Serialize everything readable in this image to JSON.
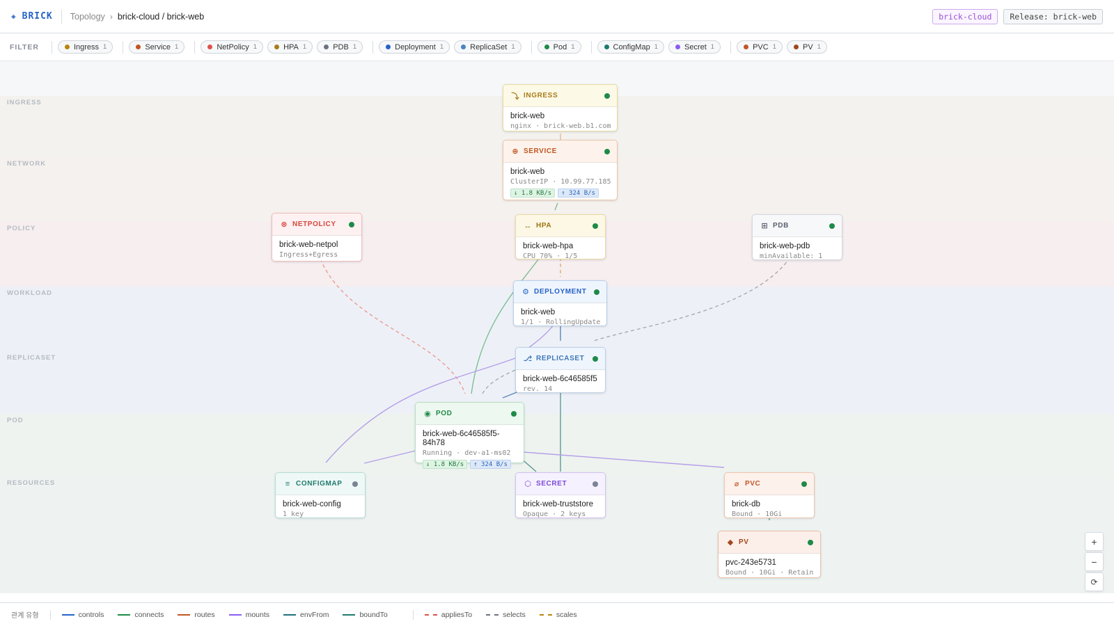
{
  "header": {
    "logo_glyph": "◈",
    "logo_text": "BRICK",
    "breadcrumb_root": "Topology",
    "breadcrumb_sep": "›",
    "breadcrumb_current": "brick-cloud / brick-web",
    "namespace_badge": "brick-cloud",
    "release_badge": "Release: brick-web"
  },
  "filter": {
    "label": "FILTER",
    "chips": [
      {
        "label": "Ingress",
        "count": "1",
        "color": "#b8860b"
      },
      {
        "label": "Service",
        "count": "1",
        "color": "#c05621"
      },
      {
        "label": "NetPolicy",
        "count": "1",
        "color": "#e0524a"
      },
      {
        "label": "HPA",
        "count": "1",
        "color": "#a77d1a"
      },
      {
        "label": "PDB",
        "count": "1",
        "color": "#6b7280"
      },
      {
        "label": "Deployment",
        "count": "1",
        "color": "#2563c9"
      },
      {
        "label": "ReplicaSet",
        "count": "1",
        "color": "#4a84c4"
      },
      {
        "label": "Pod",
        "count": "1",
        "color": "#1f8a48"
      },
      {
        "label": "ConfigMap",
        "count": "1",
        "color": "#1f7a6e"
      },
      {
        "label": "Secret",
        "count": "1",
        "color": "#8b5cf6"
      },
      {
        "label": "PVC",
        "count": "1",
        "color": "#c2552a"
      },
      {
        "label": "PV",
        "count": "1",
        "color": "#a0481e"
      }
    ]
  },
  "lanes": [
    {
      "label": "INGRESS",
      "color": "#f3f2ef"
    },
    {
      "label": "NETWORK",
      "color": "#f5f1ee"
    },
    {
      "label": "POLICY",
      "color": "#f6eeef"
    },
    {
      "label": "WORKLOAD",
      "color": "#edf1f7"
    },
    {
      "label": "REPLICASET",
      "color": "#edf1f7"
    },
    {
      "label": "POD",
      "color": "#eef3ef"
    },
    {
      "label": "RESOURCES",
      "color": "#eef3f1"
    }
  ],
  "nodes": {
    "ingress": {
      "kind": "INGRESS",
      "icon": "⤵",
      "name": "brick-web",
      "meta": "nginx · brick-web.b1.com",
      "accent": "#a77d1a",
      "head_bg": "#fdf9e7",
      "border": "#e8d9a0",
      "status_color": "#1f8a48"
    },
    "service": {
      "kind": "SERVICE",
      "icon": "⊕",
      "name": "brick-web",
      "meta": "ClusterIP · 10.99.77.185",
      "traffic_in": "↓ 1.8 KB/s",
      "traffic_out": "↑ 324 B/s",
      "accent": "#c05621",
      "head_bg": "#fdf3ec",
      "border": "#ecc6ab",
      "status_color": "#1f8a48"
    },
    "netpolicy": {
      "kind": "NETPOLICY",
      "icon": "⊗",
      "name": "brick-web-netpol",
      "meta": "Ingress+Egress",
      "accent": "#d9463e",
      "head_bg": "#fdf1f1",
      "border": "#f0bcbc",
      "status_color": "#1f8a48"
    },
    "hpa": {
      "kind": "HPA",
      "icon": "↔",
      "name": "brick-web-hpa",
      "meta": "CPU 70% · 1/5",
      "accent": "#9a7412",
      "head_bg": "#fdf8e6",
      "border": "#e8d9a0",
      "status_color": "#1f8a48"
    },
    "pdb": {
      "kind": "PDB",
      "icon": "⊞",
      "name": "brick-web-pdb",
      "meta": "minAvailable: 1",
      "accent": "#5a6270",
      "head_bg": "#f7f8fa",
      "border": "#d3d7de",
      "status_color": "#1f8a48"
    },
    "deployment": {
      "kind": "DEPLOYMENT",
      "icon": "⚙",
      "name": "brick-web",
      "meta": "1/1 · RollingUpdate",
      "accent": "#2563c9",
      "head_bg": "#eff5fd",
      "border": "#b7cdec",
      "status_color": "#1f8a48"
    },
    "replicaset": {
      "kind": "REPLICASET",
      "icon": "⎇",
      "name": "brick-web-6c46585f5",
      "meta": "rev. 14",
      "accent": "#3f78b8",
      "head_bg": "#eff5fd",
      "border": "#bcd0e8",
      "status_color": "#1f8a48"
    },
    "pod": {
      "kind": "POD",
      "icon": "◉",
      "name": "brick-web-6c46585f5-84h78",
      "meta": "Running · dev-a1-ms02",
      "traffic_in": "↓ 1.8 KB/s",
      "traffic_out": "↑ 324 B/s",
      "accent": "#1f8a48",
      "head_bg": "#edf8f0",
      "border": "#b6dfc2",
      "status_color": "#1f8a48"
    },
    "configmap": {
      "kind": "CONFIGMAP",
      "icon": "≡",
      "name": "brick-web-config",
      "meta": "1 key",
      "accent": "#1f7a6e",
      "head_bg": "#eef8f6",
      "border": "#b7ddd6",
      "status_color": "#7b8494"
    },
    "secret": {
      "kind": "SECRET",
      "icon": "⬡",
      "name": "brick-web-truststore",
      "meta": "Opaque · 2 keys",
      "accent": "#7c4bd6",
      "head_bg": "#f6f1fe",
      "border": "#d3c1f2",
      "status_color": "#7b8494"
    },
    "pvc": {
      "kind": "PVC",
      "icon": "⌀",
      "name": "brick-db",
      "meta": "Bound · 10Gi",
      "accent": "#c2552a",
      "head_bg": "#fdf1ec",
      "border": "#efc3ad",
      "status_color": "#1f8a48"
    },
    "pv": {
      "kind": "PV",
      "icon": "◆",
      "name": "pvc-243e5731",
      "meta": "Bound · 10Gi · Retain",
      "accent": "#a0481e",
      "head_bg": "#fcefe9",
      "border": "#ebbfa8",
      "status_color": "#1f8a48"
    }
  },
  "zoom": {
    "in": "+",
    "out": "−",
    "reset": "⟳"
  },
  "legend": {
    "title": "관계 유형",
    "items": [
      {
        "label": "controls",
        "color": "#2563c9",
        "dashed": false
      },
      {
        "label": "connects",
        "color": "#1f8a48",
        "dashed": false
      },
      {
        "label": "routes",
        "color": "#c05621",
        "dashed": false
      },
      {
        "label": "mounts",
        "color": "#8b5cf6",
        "dashed": false
      },
      {
        "label": "envFrom",
        "color": "#1f6f7a",
        "dashed": false
      },
      {
        "label": "boundTo",
        "color": "#1f7a6e",
        "dashed": false
      },
      {
        "label": "appliesTo",
        "color": "#e0524a",
        "dashed": true
      },
      {
        "label": "selects",
        "color": "#6b7280",
        "dashed": true
      },
      {
        "label": "scales",
        "color": "#b8860b",
        "dashed": true
      }
    ]
  }
}
